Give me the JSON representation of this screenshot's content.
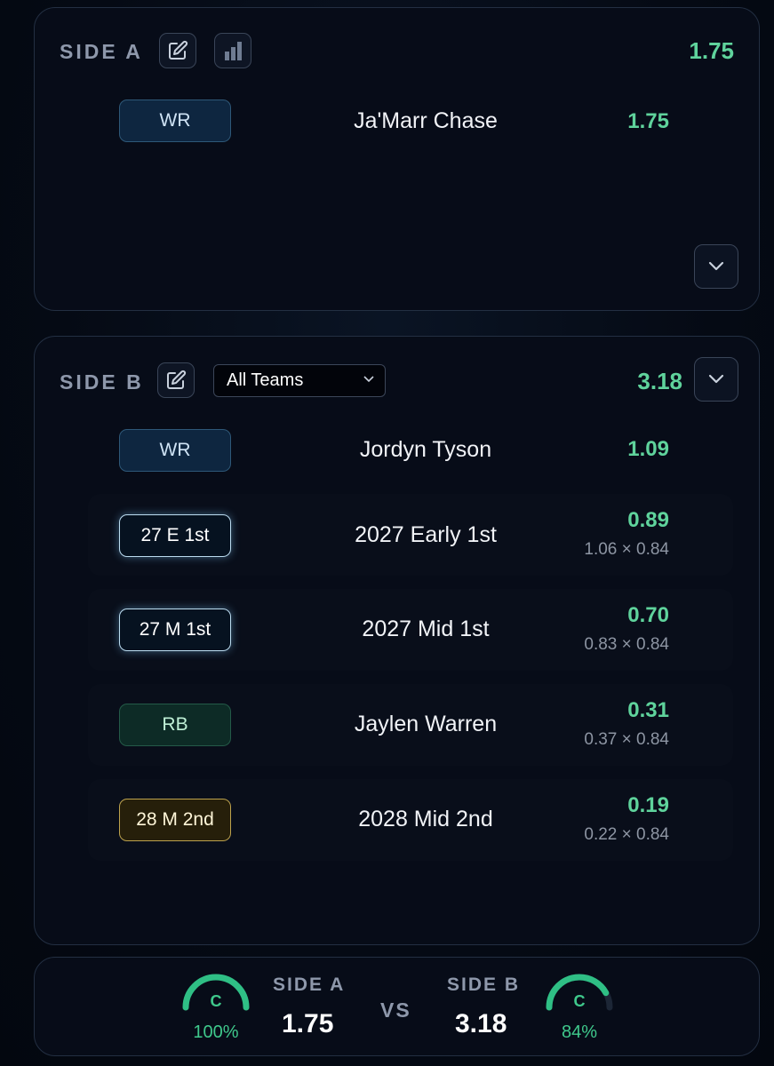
{
  "side_a": {
    "title": "SIDE A",
    "total": "1.75",
    "icons": [
      "edit-icon",
      "bar-chart-icon",
      "chevron-down-icon"
    ],
    "players": [
      {
        "position": "WR",
        "name": "Ja'Marr Chase",
        "value": "1.75"
      }
    ]
  },
  "side_b": {
    "title": "SIDE B",
    "total": "3.18",
    "team_filter": "All Teams",
    "icons": [
      "edit-icon",
      "chevron-down-icon"
    ],
    "players": [
      {
        "position": "WR",
        "name": "Jordyn Tyson",
        "value": "1.09",
        "calc": ""
      },
      {
        "position": "27 E 1st",
        "name": "2027 Early 1st",
        "value": "0.89",
        "calc": "1.06 × 0.84"
      },
      {
        "position": "27 M 1st",
        "name": "2027 Mid 1st",
        "value": "0.70",
        "calc": "0.83 × 0.84"
      },
      {
        "position": "RB",
        "name": "Jaylen Warren",
        "value": "0.31",
        "calc": "0.37 × 0.84"
      },
      {
        "position": "28 M 2nd",
        "name": "2028 Mid 2nd",
        "value": "0.19",
        "calc": "0.22 × 0.84"
      }
    ]
  },
  "summary": {
    "side_a": {
      "label": "SIDE A",
      "value": "1.75",
      "grade": "C",
      "percent": "100%",
      "gauge_fill": 1.0
    },
    "vs": "VS",
    "side_b": {
      "label": "SIDE B",
      "value": "3.18",
      "grade": "C",
      "percent": "84%",
      "gauge_fill": 0.84
    }
  },
  "colors": {
    "accent_green": "#5fd39c",
    "gauge_green": "#2fbf85",
    "panel_border": "#232f42",
    "wr_badge": "#0e2640",
    "rb_badge": "#0d2b26",
    "pick_badge_border": "#bcdcf0",
    "pick2_badge_border": "#bda24d"
  }
}
